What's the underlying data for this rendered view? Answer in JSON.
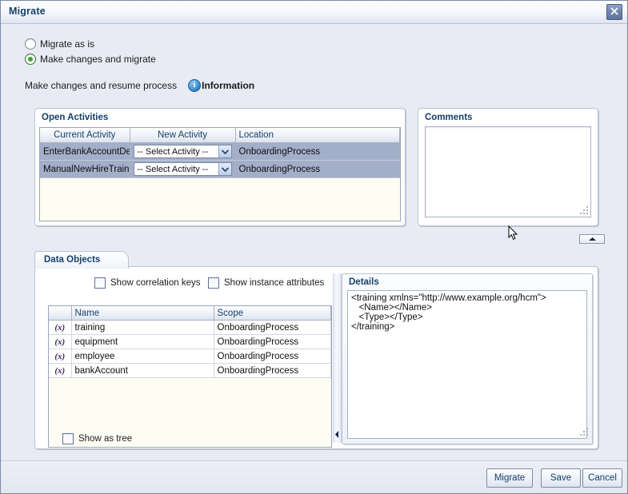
{
  "window": {
    "title": "Migrate",
    "close_icon": "close-icon"
  },
  "options": {
    "items": [
      {
        "label": "Migrate as is",
        "selected": false
      },
      {
        "label": "Make changes and migrate",
        "selected": true
      }
    ]
  },
  "subline": {
    "text": "Make changes and resume process",
    "info_glyph": "i",
    "info_label": "Information"
  },
  "open_activities": {
    "title": "Open Activities",
    "columns": [
      "Current Activity",
      "New Activity",
      "Location"
    ],
    "rows": [
      {
        "current": "EnterBankAccountDe",
        "new_activity": "-- Select Activity --",
        "location": "OnboardingProcess"
      },
      {
        "current": "ManualNewHireTrainin",
        "new_activity": "-- Select Activity --",
        "location": "OnboardingProcess"
      }
    ]
  },
  "comments": {
    "title": "Comments",
    "value": "",
    "placeholder": ""
  },
  "collapse_handle": {
    "name": "collapse-panel-handle"
  },
  "data_objects": {
    "tab_label": "Data Objects",
    "checkboxes": [
      {
        "label": "Show correlation keys",
        "checked": false
      },
      {
        "label": "Show instance attributes",
        "checked": false
      },
      {
        "label": "Show as tree",
        "checked": false
      }
    ],
    "columns": [
      "",
      "Name",
      "Scope"
    ],
    "rows": [
      {
        "icon": "(x)",
        "name": "training",
        "scope": "OnboardingProcess"
      },
      {
        "icon": "(x)",
        "name": "equipment",
        "scope": "OnboardingProcess"
      },
      {
        "icon": "(x)",
        "name": "employee",
        "scope": "OnboardingProcess"
      },
      {
        "icon": "(x)",
        "name": "bankAccount",
        "scope": "OnboardingProcess"
      }
    ]
  },
  "details": {
    "title": "Details",
    "content": "<training xmlns=\"http://www.example.org/hcm\">\n   <Name></Name>\n   <Type></Type>\n</training>"
  },
  "footer": {
    "migrate": "Migrate",
    "save": "Save",
    "cancel": "Cancel"
  },
  "colors": {
    "dialog_bg": "#e8ebf4",
    "title_text": "#13406a",
    "selected_row": "#a3aec9",
    "grid_bg": "#fdfdf3",
    "radio_selected": "#3ea32f"
  }
}
